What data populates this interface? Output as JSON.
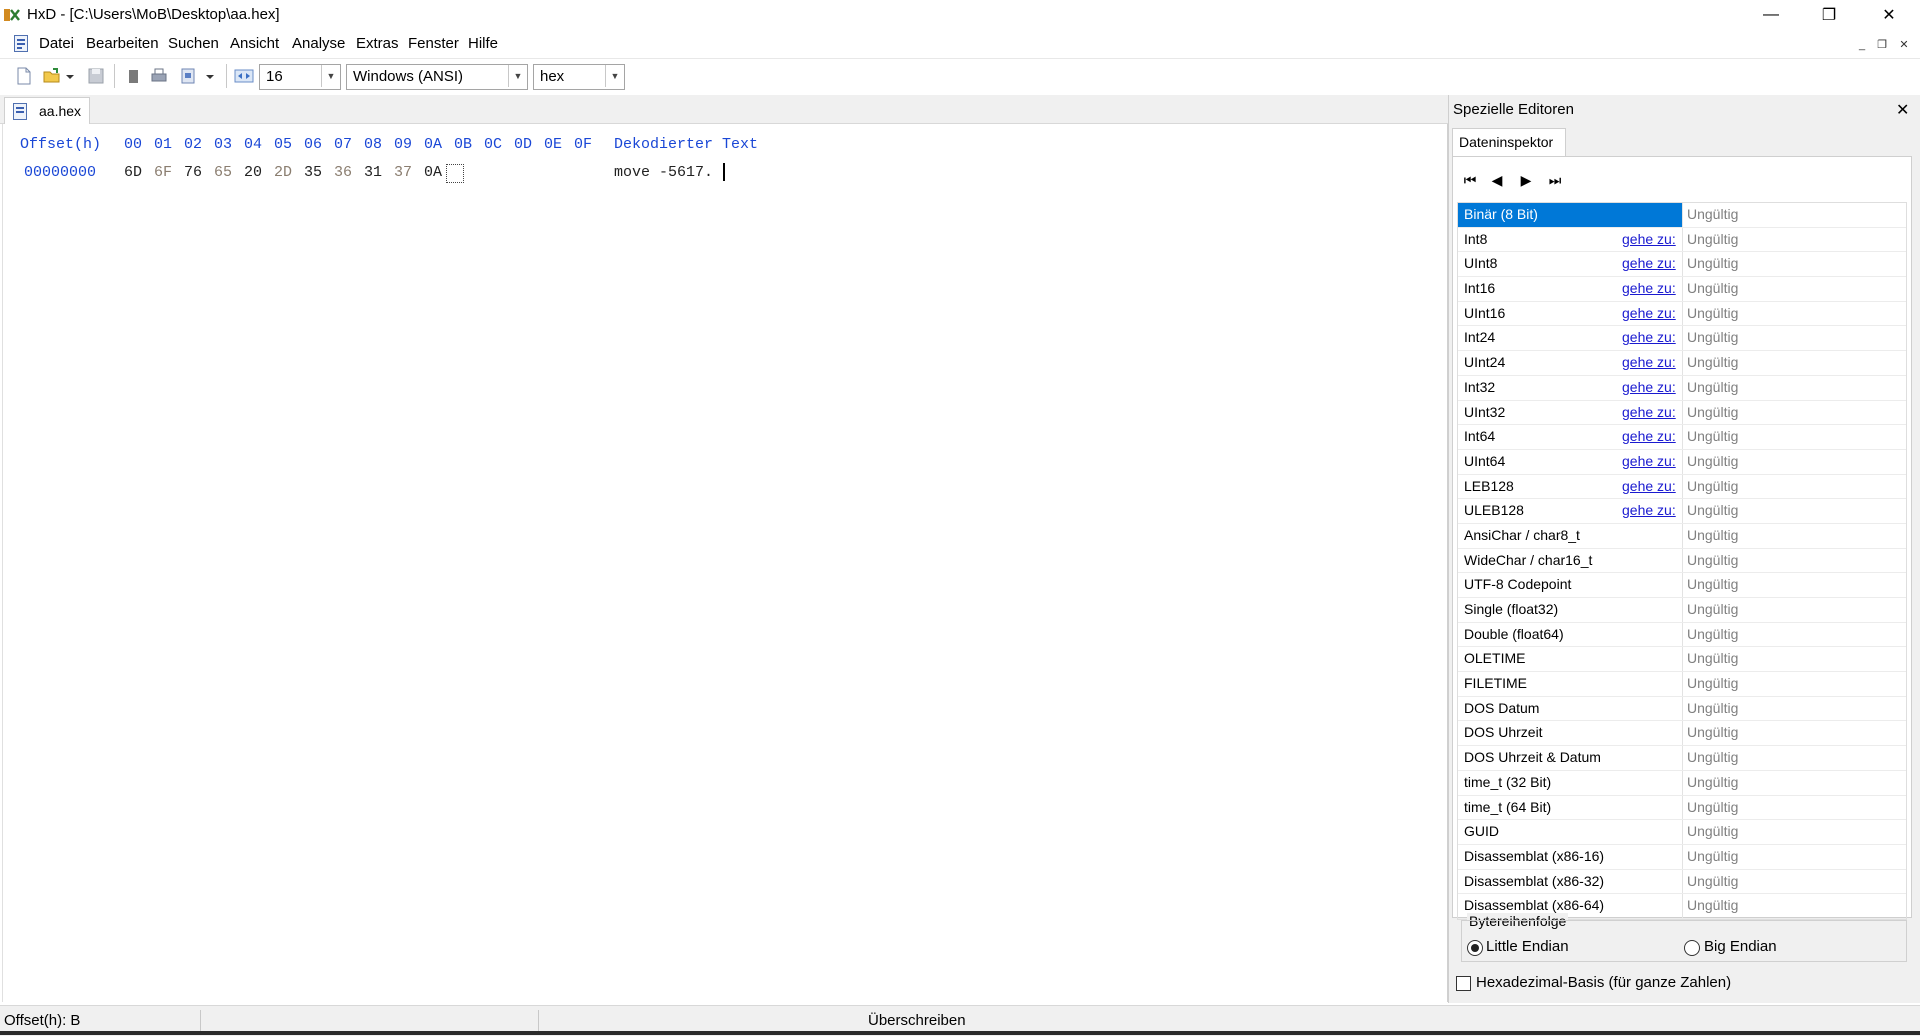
{
  "window": {
    "title": "HxD - [C:\\Users\\MoB\\Desktop\\aa.hex]",
    "controls": {
      "minimize": "—",
      "maximize": "❐",
      "close": "✕"
    }
  },
  "menu": {
    "items": [
      "Datei",
      "Bearbeiten",
      "Suchen",
      "Ansicht",
      "Analyse",
      "Extras",
      "Fenster",
      "Hilfe"
    ],
    "mdi": {
      "minimize": "_",
      "restore": "❐",
      "close": "✕"
    }
  },
  "toolbar": {
    "bytes_per_row": "16",
    "charset": "Windows (ANSI)",
    "offset_base": "hex"
  },
  "document": {
    "tab_label": "aa.hex",
    "header_offset": "Offset(h)",
    "header_bytes": [
      "00",
      "01",
      "02",
      "03",
      "04",
      "05",
      "06",
      "07",
      "08",
      "09",
      "0A",
      "0B",
      "0C",
      "0D",
      "0E",
      "0F"
    ],
    "header_text": "Dekodierter Text",
    "rows": [
      {
        "offset": "00000000",
        "bytes": [
          "6D",
          "6F",
          "76",
          "65",
          "20",
          "2D",
          "35",
          "36",
          "31",
          "37",
          "0A"
        ],
        "text": "move -5617."
      }
    ]
  },
  "status": {
    "offset": "Offset(h): B",
    "mode": "Überschreiben"
  },
  "side_panel": {
    "title": "Spezielle Editoren",
    "close": "✕",
    "tab": "Dateninspektor",
    "nav": [
      "⏮",
      "◀",
      "▶",
      "⏭"
    ],
    "goto_label": "gehe zu:",
    "rows": [
      {
        "name": "Binär (8 Bit)",
        "goto": false,
        "value": "Ungültig",
        "selected": true
      },
      {
        "name": "Int8",
        "goto": true,
        "value": "Ungültig"
      },
      {
        "name": "UInt8",
        "goto": true,
        "value": "Ungültig"
      },
      {
        "name": "Int16",
        "goto": true,
        "value": "Ungültig"
      },
      {
        "name": "UInt16",
        "goto": true,
        "value": "Ungültig"
      },
      {
        "name": "Int24",
        "goto": true,
        "value": "Ungültig"
      },
      {
        "name": "UInt24",
        "goto": true,
        "value": "Ungültig"
      },
      {
        "name": "Int32",
        "goto": true,
        "value": "Ungültig"
      },
      {
        "name": "UInt32",
        "goto": true,
        "value": "Ungültig"
      },
      {
        "name": "Int64",
        "goto": true,
        "value": "Ungültig"
      },
      {
        "name": "UInt64",
        "goto": true,
        "value": "Ungültig"
      },
      {
        "name": "LEB128",
        "goto": true,
        "value": "Ungültig"
      },
      {
        "name": "ULEB128",
        "goto": true,
        "value": "Ungültig"
      },
      {
        "name": "AnsiChar / char8_t",
        "goto": false,
        "value": "Ungültig"
      },
      {
        "name": "WideChar / char16_t",
        "goto": false,
        "value": "Ungültig"
      },
      {
        "name": "UTF-8 Codepoint",
        "goto": false,
        "value": "Ungültig"
      },
      {
        "name": "Single (float32)",
        "goto": false,
        "value": "Ungültig"
      },
      {
        "name": "Double (float64)",
        "goto": false,
        "value": "Ungültig"
      },
      {
        "name": "OLETIME",
        "goto": false,
        "value": "Ungültig"
      },
      {
        "name": "FILETIME",
        "goto": false,
        "value": "Ungültig"
      },
      {
        "name": "DOS Datum",
        "goto": false,
        "value": "Ungültig"
      },
      {
        "name": "DOS Uhrzeit",
        "goto": false,
        "value": "Ungültig"
      },
      {
        "name": "DOS Uhrzeit & Datum",
        "goto": false,
        "value": "Ungültig"
      },
      {
        "name": "time_t (32 Bit)",
        "goto": false,
        "value": "Ungültig"
      },
      {
        "name": "time_t (64 Bit)",
        "goto": false,
        "value": "Ungültig"
      },
      {
        "name": "GUID",
        "goto": false,
        "value": "Ungültig"
      },
      {
        "name": "Disassemblat (x86-16)",
        "goto": false,
        "value": "Ungültig"
      },
      {
        "name": "Disassemblat (x86-32)",
        "goto": false,
        "value": "Ungültig"
      },
      {
        "name": "Disassemblat (x86-64)",
        "goto": false,
        "value": "Ungültig"
      }
    ],
    "byte_order": {
      "title": "Bytereihenfolge",
      "little": "Little Endian",
      "big": "Big Endian",
      "selected": "little"
    },
    "hex_base_label": "Hexadezimal-Basis (für ganze Zahlen)"
  },
  "colors": {
    "accent_blue": "#1a47d6",
    "selection": "#0078d7",
    "link": "#1a1ad0",
    "invalid_gray": "#808080"
  }
}
